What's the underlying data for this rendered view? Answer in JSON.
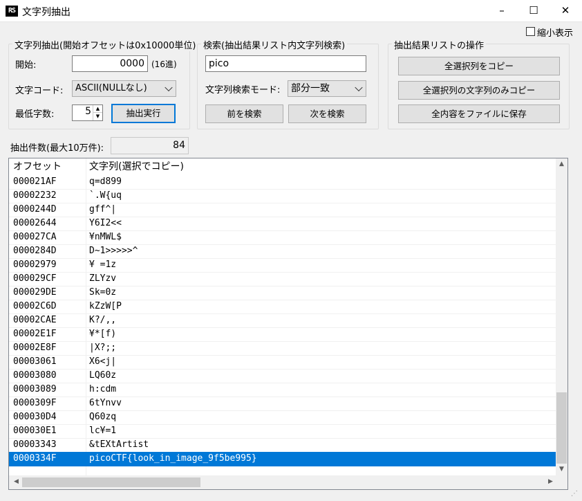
{
  "window": {
    "icon_text": "RS",
    "title": "文字列抽出",
    "minimize": "–",
    "maximize": "☐",
    "close": "✕"
  },
  "compact_view": {
    "label": "縮小表示",
    "checked": false
  },
  "extract_group": {
    "title": "文字列抽出(開始オフセットは0x10000単位)",
    "start_label": "開始:",
    "start_value": "0000",
    "start_unit": "(16進)",
    "encoding_label": "文字コード:",
    "encoding_value": "ASCII(NULLなし)",
    "min_len_label": "最低字数:",
    "min_len_value": "5",
    "run_button": "抽出実行"
  },
  "search_group": {
    "title": "検索(抽出結果リスト内文字列検索)",
    "query": "pico",
    "mode_label": "文字列検索モード:",
    "mode_value": "部分一致",
    "prev_button": "前を検索",
    "next_button": "次を検索"
  },
  "ops_group": {
    "title": "抽出結果リストの操作",
    "copy_all_button": "全選択列をコピー",
    "copy_strings_button": "全選択列の文字列のみコピー",
    "save_button": "全内容をファイルに保存"
  },
  "count": {
    "label": "抽出件数(最大10万件):",
    "value": "84"
  },
  "list": {
    "col_offset": "オフセット",
    "col_string": "文字列(選択でコピー)",
    "rows": [
      {
        "offset": "000021AF",
        "text": "q=d899"
      },
      {
        "offset": "00002232",
        "text": "`.W{uq"
      },
      {
        "offset": "0000244D",
        "text": "gff^|"
      },
      {
        "offset": "00002644",
        "text": "Y6I2<<"
      },
      {
        "offset": "000027CA",
        "text": "¥nMWL$"
      },
      {
        "offset": "0000284D",
        "text": "D~1>>>>>^"
      },
      {
        "offset": "00002979",
        "text": "¥ =1z"
      },
      {
        "offset": "000029CF",
        "text": "ZLYzv"
      },
      {
        "offset": "000029DE",
        "text": "Sk=0z"
      },
      {
        "offset": "00002C6D",
        "text": "kZzW[P"
      },
      {
        "offset": "00002CAE",
        "text": "K?/,,"
      },
      {
        "offset": "00002E1F",
        "text": "¥*[f)"
      },
      {
        "offset": "00002E8F",
        "text": "|X?;;"
      },
      {
        "offset": "00003061",
        "text": "X6<j|"
      },
      {
        "offset": "00003080",
        "text": "LQ60z"
      },
      {
        "offset": "00003089",
        "text": "h:cdm"
      },
      {
        "offset": "0000309F",
        "text": "6tYnvv"
      },
      {
        "offset": "000030D4",
        "text": "Q60zq"
      },
      {
        "offset": "000030E1",
        "text": "lc¥=1"
      },
      {
        "offset": "00003343",
        "text": "&tEXtArtist"
      },
      {
        "offset": "0000334F",
        "text": "picoCTF{look_in_image_9f5be995}",
        "selected": true
      }
    ]
  }
}
